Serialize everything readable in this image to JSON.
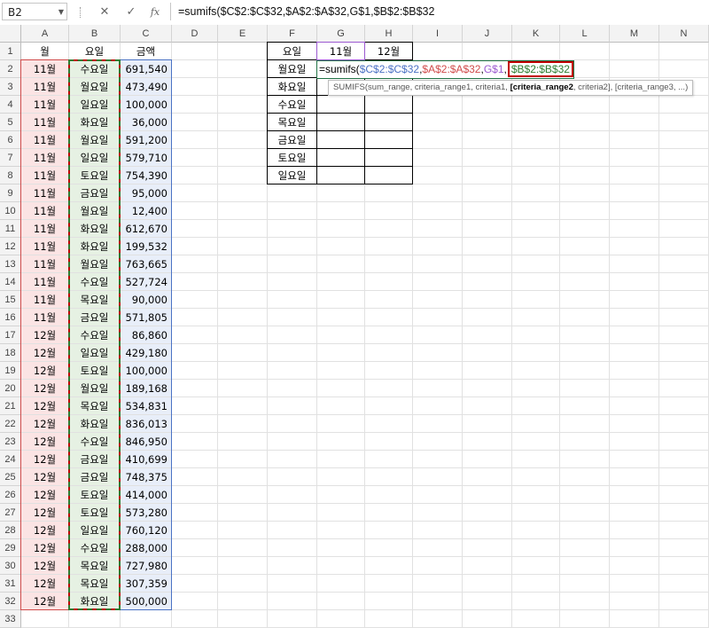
{
  "formula_bar": {
    "name_box": "B2",
    "cancel_icon": "✕",
    "enter_icon": "✓",
    "function_icon": "fx",
    "formula": "=sumifs($C$2:$C$32,$A$2:$A$32,G$1,$B$2:$B$32"
  },
  "columns": [
    "A",
    "B",
    "C",
    "D",
    "E",
    "F",
    "G",
    "H",
    "I",
    "J",
    "K",
    "L",
    "M",
    "N"
  ],
  "rows": [
    "1",
    "2",
    "3",
    "4",
    "5",
    "6",
    "7",
    "8",
    "9",
    "10",
    "11",
    "12",
    "13",
    "14",
    "15",
    "16",
    "17",
    "18",
    "19",
    "20",
    "21",
    "22",
    "23",
    "24",
    "25",
    "26",
    "27",
    "28",
    "29",
    "30",
    "31",
    "32",
    "33"
  ],
  "data": {
    "headers": {
      "month": "월",
      "day": "요일",
      "amount": "금액"
    },
    "records": [
      {
        "month": "11월",
        "day": "수요일",
        "amount": "691,540"
      },
      {
        "month": "11월",
        "day": "월요일",
        "amount": "473,490"
      },
      {
        "month": "11월",
        "day": "일요일",
        "amount": "100,000"
      },
      {
        "month": "11월",
        "day": "화요일",
        "amount": "36,000"
      },
      {
        "month": "11월",
        "day": "월요일",
        "amount": "591,200"
      },
      {
        "month": "11월",
        "day": "일요일",
        "amount": "579,710"
      },
      {
        "month": "11월",
        "day": "토요일",
        "amount": "754,390"
      },
      {
        "month": "11월",
        "day": "금요일",
        "amount": "95,000"
      },
      {
        "month": "11월",
        "day": "월요일",
        "amount": "12,400"
      },
      {
        "month": "11월",
        "day": "화요일",
        "amount": "612,670"
      },
      {
        "month": "11월",
        "day": "화요일",
        "amount": "199,532"
      },
      {
        "month": "11월",
        "day": "월요일",
        "amount": "763,665"
      },
      {
        "month": "11월",
        "day": "수요일",
        "amount": "527,724"
      },
      {
        "month": "11월",
        "day": "목요일",
        "amount": "90,000"
      },
      {
        "month": "11월",
        "day": "금요일",
        "amount": "571,805"
      },
      {
        "month": "12월",
        "day": "수요일",
        "amount": "86,860"
      },
      {
        "month": "12월",
        "day": "일요일",
        "amount": "429,180"
      },
      {
        "month": "12월",
        "day": "토요일",
        "amount": "100,000"
      },
      {
        "month": "12월",
        "day": "월요일",
        "amount": "189,168"
      },
      {
        "month": "12월",
        "day": "목요일",
        "amount": "534,831"
      },
      {
        "month": "12월",
        "day": "화요일",
        "amount": "836,013"
      },
      {
        "month": "12월",
        "day": "수요일",
        "amount": "846,950"
      },
      {
        "month": "12월",
        "day": "금요일",
        "amount": "410,699"
      },
      {
        "month": "12월",
        "day": "금요일",
        "amount": "748,375"
      },
      {
        "month": "12월",
        "day": "토요일",
        "amount": "414,000"
      },
      {
        "month": "12월",
        "day": "토요일",
        "amount": "573,280"
      },
      {
        "month": "12월",
        "day": "일요일",
        "amount": "760,120"
      },
      {
        "month": "12월",
        "day": "수요일",
        "amount": "288,000"
      },
      {
        "month": "12월",
        "day": "목요일",
        "amount": "727,980"
      },
      {
        "month": "12월",
        "day": "목요일",
        "amount": "307,359"
      },
      {
        "month": "12월",
        "day": "화요일",
        "amount": "500,000"
      }
    ]
  },
  "summary": {
    "header": [
      "요일",
      "11월",
      "12월"
    ],
    "days": [
      "월요일",
      "화요일",
      "수요일",
      "목요일",
      "금요일",
      "토요일",
      "일요일"
    ],
    "editing_formula": {
      "prefix": "=sumifs(",
      "arg1": "$C$2:$C$32",
      "comma1": ",",
      "arg2": "$A$2:$A$32",
      "comma2": ",",
      "arg3": "G$1",
      "comma3": ",",
      "arg4": "$B$2:$B$32"
    },
    "tooltip": {
      "pre": "SUMIFS(sum_range, criteria_range1, criteria1, ",
      "bold": "[criteria_range2",
      "post": ", criteria2], [criteria_range3, ...)"
    }
  },
  "colors": {
    "range_red": "#d04b4b",
    "range_green": "#2f7d32",
    "range_blue": "#4b72c4",
    "range_purple": "#9b59d0",
    "outline_darkred": "#c00000"
  }
}
